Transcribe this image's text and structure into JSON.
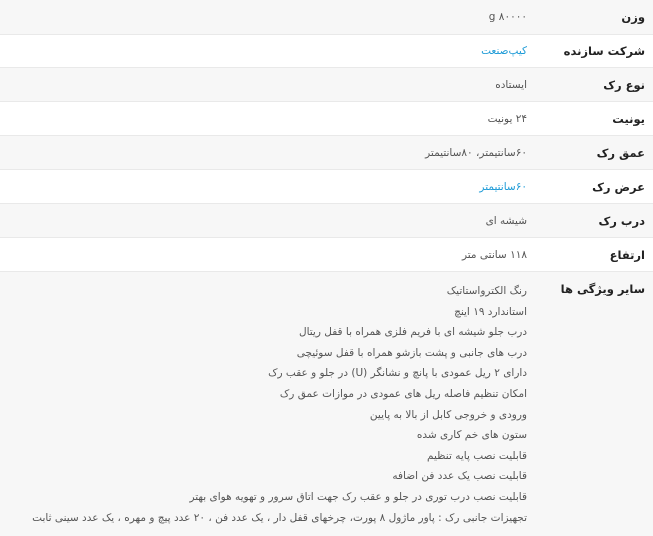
{
  "specs": [
    {
      "label": "وزن",
      "value": "g ۸۰۰۰۰",
      "link": false
    },
    {
      "label": "شرکت سازنده",
      "value": "کیپ‌صنعت",
      "link": true
    },
    {
      "label": "نوع رک",
      "value": "ایستاده",
      "link": false
    },
    {
      "label": "یونیت",
      "value": "۲۴ یونیت",
      "link": false
    },
    {
      "label": "عمق رک",
      "value": "۶۰سانتیمتر، ۸۰سانتیمتر",
      "link": false
    },
    {
      "label": "عرض رک",
      "value": "۶۰سانتیمتر",
      "link": true
    },
    {
      "label": "درب رک",
      "value": "شیشه ای",
      "link": false
    },
    {
      "label": "ارتفاع",
      "value": "۱۱۸ سانتی متر",
      "link": false
    }
  ],
  "features": {
    "label": "سایر ویژگی ها",
    "items": [
      "رنگ الکترواستاتیک",
      "استاندارد ۱۹ اینچ",
      "درب جلو شیشه ای با فریم فلزی همراه با قفل ریتال",
      "درب های جانبی و پشت بازشو همراه با قفل سوئیچی",
      "دارای ۲ ریل عمودی با پانچ و نشانگر (U) در جلو و عقب رک",
      "امکان تنظیم فاصله ریل های عمودی در موازات عمق رک",
      "ورودی و خروجی کابل از بالا به پایین",
      "ستون های خم کاری شده",
      "قابلیت نصب پایه تنظیم",
      "قابلیت نصب یک عدد فن اضافه",
      "قابلیت نصب درب توری در جلو و عقب رک جهت اتاق سرور و تهویه هوای بهتر",
      "تجهیزات جانبی رک : پاور ماژول ۸ پورت، چرخهای قفل دار ، یک عدد فن ، ۲۰ عدد پیچ و مهره ، یک عدد سینی ثابت"
    ]
  }
}
